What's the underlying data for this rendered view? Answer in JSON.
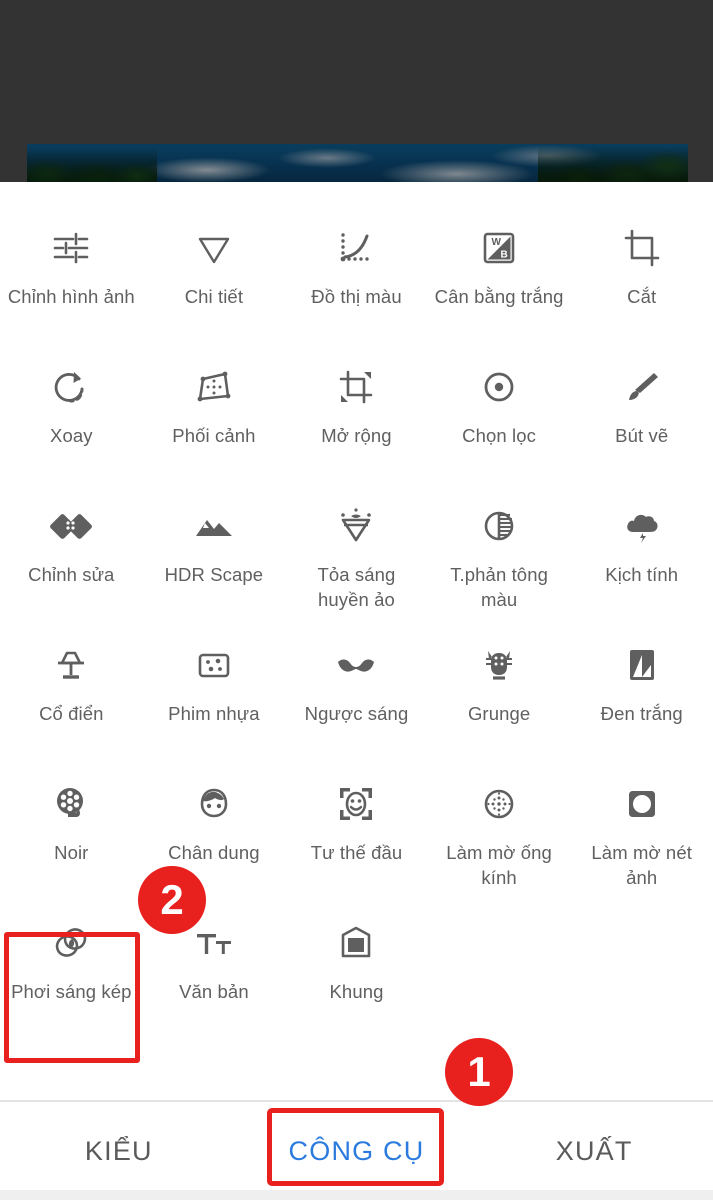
{
  "app": {
    "background_color": "#333333",
    "sheet_color": "#ffffff",
    "icon_color": "#5f5f5f",
    "label_color": "#606060",
    "accent_color": "#2b7bdf",
    "annotation_color": "#e8201e"
  },
  "preview": {
    "name": "photo-preview-strip",
    "description": "sky with clouds and trees"
  },
  "tools": [
    {
      "label": "Chỉnh hình ảnh",
      "icon": "tune-sliders-icon"
    },
    {
      "label": "Chi tiết",
      "icon": "details-triangle-icon"
    },
    {
      "label": "Đồ thị màu",
      "icon": "curves-icon"
    },
    {
      "label": "Cân bằng trắng",
      "icon": "white-balance-icon"
    },
    {
      "label": "Cắt",
      "icon": "crop-icon"
    },
    {
      "label": "Xoay",
      "icon": "rotate-icon"
    },
    {
      "label": "Phối cảnh",
      "icon": "perspective-icon"
    },
    {
      "label": "Mở rộng",
      "icon": "expand-icon"
    },
    {
      "label": "Chọn lọc",
      "icon": "selective-icon"
    },
    {
      "label": "Bút vẽ",
      "icon": "brush-icon"
    },
    {
      "label": "Chỉnh sửa",
      "icon": "healing-patch-icon"
    },
    {
      "label": "HDR Scape",
      "icon": "mountains-icon"
    },
    {
      "label": "Tỏa sáng huyền ảo",
      "icon": "glamour-glow-icon"
    },
    {
      "label": "T.phản tông màu",
      "icon": "tonal-contrast-icon"
    },
    {
      "label": "Kịch tính",
      "icon": "drama-cloud-icon"
    },
    {
      "label": "Cổ điển",
      "icon": "vintage-lamp-icon"
    },
    {
      "label": "Phim nhựa",
      "icon": "grainy-film-icon"
    },
    {
      "label": "Ngược sáng",
      "icon": "retrolux-moustache-icon"
    },
    {
      "label": "Grunge",
      "icon": "grunge-icon"
    },
    {
      "label": "Đen trắng",
      "icon": "black-white-icon"
    },
    {
      "label": "Noir",
      "icon": "noir-film-reel-icon"
    },
    {
      "label": "Chân dung",
      "icon": "portrait-face-icon"
    },
    {
      "label": "Tư thế đầu",
      "icon": "head-pose-icon"
    },
    {
      "label": "Làm mờ ống kính",
      "icon": "lens-blur-icon"
    },
    {
      "label": "Làm mờ nét ảnh",
      "icon": "vignette-icon"
    },
    {
      "label": "Phơi sáng kép",
      "icon": "double-exposure-icon"
    },
    {
      "label": "Văn bản",
      "icon": "text-icon"
    },
    {
      "label": "Khung",
      "icon": "frames-icon"
    }
  ],
  "tabs": [
    {
      "label": "KIỂU",
      "active": false
    },
    {
      "label": "CÔNG CỤ",
      "active": true
    },
    {
      "label": "XUẤT",
      "active": false
    }
  ],
  "annotations": {
    "badge_one": "1",
    "badge_two": "2",
    "highlight_tool": "Phơi sáng kép",
    "highlight_tab": "CÔNG CỤ"
  }
}
